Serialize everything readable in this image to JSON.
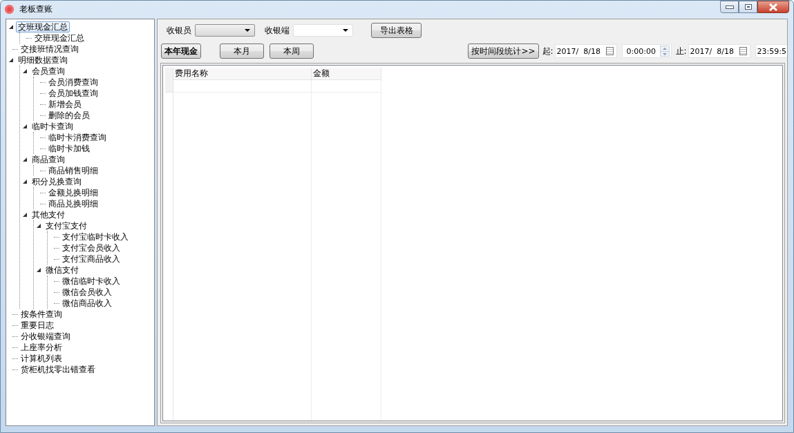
{
  "window": {
    "title": "老板查账"
  },
  "tree": [
    {
      "label": "交班现金汇总",
      "selected": true,
      "expanded": true,
      "children": [
        {
          "label": "交班现金汇总",
          "selected": false
        }
      ]
    },
    {
      "label": "交接班情况查询",
      "selected": false
    },
    {
      "label": "明细数据查询",
      "selected": false,
      "expanded": true,
      "children": [
        {
          "label": "会员查询",
          "selected": false,
          "expanded": true,
          "children": [
            {
              "label": "会员消费查询",
              "selected": false
            },
            {
              "label": "会员加钱查询",
              "selected": false
            },
            {
              "label": "新增会员",
              "selected": false
            },
            {
              "label": "删除的会员",
              "selected": false
            }
          ]
        },
        {
          "label": "临时卡查询",
          "selected": false,
          "expanded": true,
          "children": [
            {
              "label": "临时卡消费查询",
              "selected": false
            },
            {
              "label": "临时卡加钱",
              "selected": false
            }
          ]
        },
        {
          "label": "商品查询",
          "selected": false,
          "expanded": true,
          "children": [
            {
              "label": "商品销售明细",
              "selected": false
            }
          ]
        },
        {
          "label": "积分兑换查询",
          "selected": false,
          "expanded": true,
          "children": [
            {
              "label": "金额兑换明细",
              "selected": false
            },
            {
              "label": "商品兑换明细",
              "selected": false
            }
          ]
        },
        {
          "label": "其他支付",
          "selected": false,
          "expanded": true,
          "children": [
            {
              "label": "支付宝支付",
              "selected": false,
              "expanded": true,
              "children": [
                {
                  "label": "支付宝临时卡收入",
                  "selected": false
                },
                {
                  "label": "支付宝会员收入",
                  "selected": false
                },
                {
                  "label": "支付宝商品收入",
                  "selected": false
                }
              ]
            },
            {
              "label": "微信支付",
              "selected": false,
              "expanded": true,
              "children": [
                {
                  "label": "微信临时卡收入",
                  "selected": false
                },
                {
                  "label": "微信会员收入",
                  "selected": false
                },
                {
                  "label": "微信商品收入",
                  "selected": false
                }
              ]
            }
          ]
        }
      ]
    },
    {
      "label": "按条件查询",
      "selected": false
    },
    {
      "label": "重要日志",
      "selected": false
    },
    {
      "label": "分收银端查询",
      "selected": false
    },
    {
      "label": "上座率分析",
      "selected": false
    },
    {
      "label": "计算机列表",
      "selected": false
    },
    {
      "label": "货柜机找零出错查看",
      "selected": false
    }
  ],
  "filters": {
    "cashier_label": "收银员",
    "terminal_label": "收银端",
    "export_button": "导出表格"
  },
  "period_buttons": [
    {
      "label": "本年现金",
      "selected": true
    },
    {
      "label": "本月",
      "selected": false
    },
    {
      "label": "本周",
      "selected": false
    }
  ],
  "range": {
    "button": "按时间段统计>>",
    "start_label": "起:",
    "start_date": "2017/  8/18",
    "start_time": "0:00:00",
    "end_label": "止:",
    "end_date": "2017/  8/18",
    "end_time": "23:59:5"
  },
  "table": {
    "columns": [
      "费用名称",
      "金额"
    ]
  }
}
